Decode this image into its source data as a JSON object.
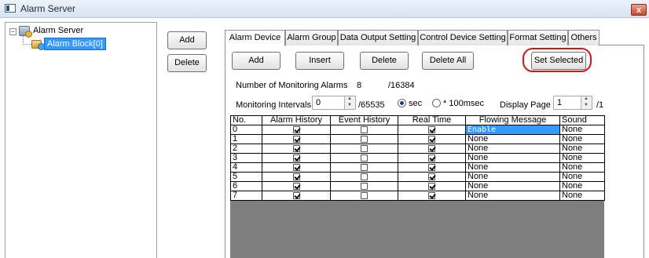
{
  "window": {
    "title": "Alarm Server",
    "close_glyph": "x"
  },
  "tree": {
    "root_label": "Alarm Server",
    "expander": "−",
    "child_label": "Alarm Block[0]",
    "root_icon": "server-icon",
    "child_icon": "alarm-block-icon"
  },
  "left_buttons": {
    "add": "Add",
    "delete": "Delete"
  },
  "tabs": [
    "Alarm Device",
    "Alarm Group",
    "Data Output Setting",
    "Control Device Setting",
    "Format Setting",
    "Others"
  ],
  "active_tab": "Alarm Device",
  "actions": {
    "add": "Add",
    "insert": "Insert",
    "delete": "Delete",
    "delete_all": "Delete All",
    "set_selected": "Set Selected"
  },
  "monitoring": {
    "count_label": "Number of Monitoring Alarms",
    "count": "8",
    "count_max": "/16384",
    "interval_label": "Monitoring Intervals",
    "interval_value": "0",
    "interval_max": "/65535",
    "unit_sec": "sec",
    "unit_100msec": "* 100msec",
    "unit_selected": "sec",
    "page_label": "Display Page",
    "page_value": "1",
    "page_max": "/1"
  },
  "table": {
    "columns": [
      "No.",
      "Alarm History",
      "Event History",
      "Real Time",
      "Flowing Message",
      "Sound"
    ],
    "rows": [
      {
        "no": "0",
        "alarm_history": true,
        "event_history": false,
        "real_time": true,
        "flowing_message": "Enable",
        "sound": "None"
      },
      {
        "no": "1",
        "alarm_history": true,
        "event_history": false,
        "real_time": true,
        "flowing_message": "None",
        "sound": "None"
      },
      {
        "no": "2",
        "alarm_history": true,
        "event_history": false,
        "real_time": true,
        "flowing_message": "None",
        "sound": "None"
      },
      {
        "no": "3",
        "alarm_history": true,
        "event_history": false,
        "real_time": true,
        "flowing_message": "None",
        "sound": "None"
      },
      {
        "no": "4",
        "alarm_history": true,
        "event_history": false,
        "real_time": true,
        "flowing_message": "None",
        "sound": "None"
      },
      {
        "no": "5",
        "alarm_history": true,
        "event_history": false,
        "real_time": true,
        "flowing_message": "None",
        "sound": "None"
      },
      {
        "no": "6",
        "alarm_history": true,
        "event_history": false,
        "real_time": true,
        "flowing_message": "None",
        "sound": "None"
      },
      {
        "no": "7",
        "alarm_history": true,
        "event_history": false,
        "real_time": true,
        "flowing_message": "None",
        "sound": "None"
      }
    ],
    "selected_cell": {
      "row": 0,
      "column": "flowing_message"
    }
  },
  "colors": {
    "highlight": "#e01010",
    "selection": "#3399ff"
  }
}
